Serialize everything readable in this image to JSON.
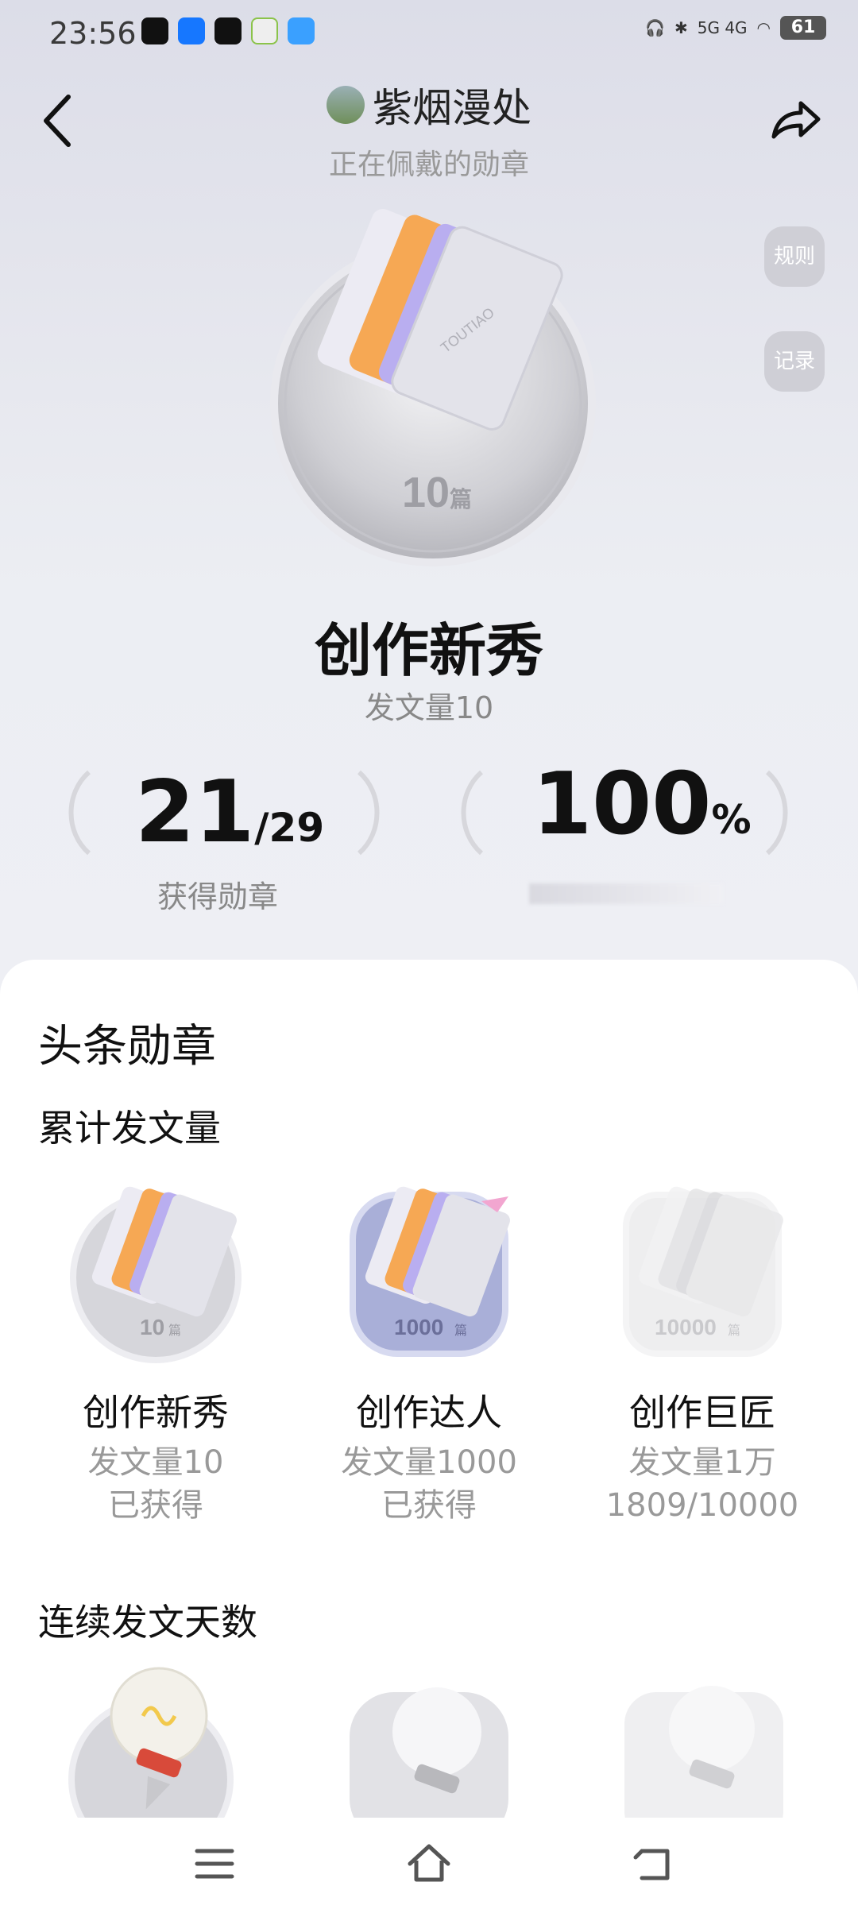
{
  "status": {
    "time": "23:56",
    "battery": "61",
    "network": "5G 4G"
  },
  "header": {
    "username": "紫烟漫处",
    "subtitle": "正在佩戴的勋章"
  },
  "side_buttons": {
    "rules": "规则",
    "records": "记录"
  },
  "current_medal": {
    "title": "创作新秀",
    "subtitle": "发文量10",
    "badge_number": "10",
    "badge_unit": "篇",
    "brand": "TOUTIAO"
  },
  "stats": {
    "earned_count": "21",
    "earned_total": "/29",
    "earned_label": "获得勋章",
    "percent": "100",
    "percent_sign": "%"
  },
  "section": {
    "title": "头条勋章",
    "group1_title": "累计发文量",
    "group1_items": [
      {
        "name": "创作新秀",
        "desc": "发文量10",
        "status": "已获得",
        "badge_number": "10",
        "badge_unit": "篇"
      },
      {
        "name": "创作达人",
        "desc": "发文量1000",
        "status": "已获得",
        "badge_number": "1000",
        "badge_unit": "篇"
      },
      {
        "name": "创作巨匠",
        "desc": "发文量1万",
        "status": "1809/10000",
        "badge_number": "10000",
        "badge_unit": "篇"
      }
    ],
    "group2_title": "连续发文天数"
  },
  "colors": {
    "accent_orange": "#f6a854",
    "accent_purple": "#a99ae6",
    "text_primary": "#111111",
    "text_secondary": "#999999"
  }
}
